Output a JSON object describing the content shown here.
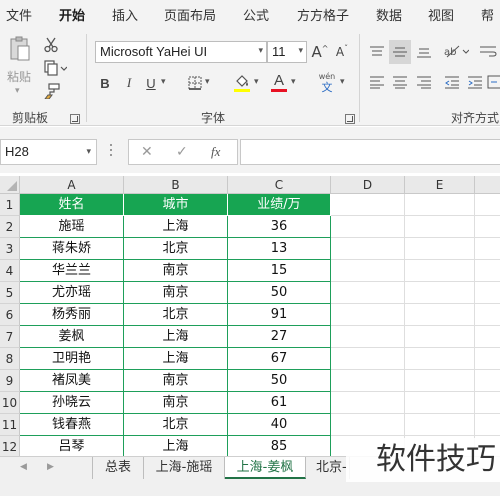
{
  "menu": [
    "文件",
    "开始",
    "插入",
    "页面布局",
    "公式",
    "方方格子",
    "数据",
    "视图",
    "帮"
  ],
  "ribbon": {
    "paste_label": "粘贴",
    "font_name": "Microsoft YaHei UI",
    "font_size": "11",
    "bold": "B",
    "italic": "I",
    "underline": "U",
    "font_color_letter": "A",
    "phonetic_top": "wén",
    "phonetic_bottom": "文",
    "grow_font": "A",
    "shrink_font": "A",
    "clipboard_label": "剪贴板",
    "font_label": "字体",
    "align_label": "对齐方式",
    "font_color": "#e81123",
    "fill_color": "#ffff00"
  },
  "formula_bar": {
    "name_box": "H28",
    "cancel_glyph": "✕",
    "enter_glyph": "✓",
    "fx_label": "fx",
    "formula": ""
  },
  "sheet": {
    "columns": [
      "A",
      "B",
      "C",
      "D",
      "E"
    ],
    "row_numbers": [
      "1",
      "2",
      "3",
      "4",
      "5",
      "6",
      "7",
      "8",
      "9",
      "10",
      "11",
      "12"
    ],
    "header": [
      "姓名",
      "城市",
      "业绩/万"
    ],
    "rows": [
      [
        "施瑶",
        "上海",
        "36"
      ],
      [
        "蒋朱娇",
        "北京",
        "13"
      ],
      [
        "华兰兰",
        "南京",
        "15"
      ],
      [
        "尤亦瑶",
        "南京",
        "50"
      ],
      [
        "杨秀丽",
        "北京",
        "91"
      ],
      [
        "姜枫",
        "上海",
        "27"
      ],
      [
        "卫明艳",
        "上海",
        "67"
      ],
      [
        "褚凤美",
        "南京",
        "50"
      ],
      [
        "孙晓云",
        "南京",
        "61"
      ],
      [
        "钱春燕",
        "北京",
        "40"
      ],
      [
        "吕琴",
        "上海",
        "85"
      ]
    ],
    "header_color": "#17a552",
    "border_color": "#1e9f5a"
  },
  "sheet_tabs": [
    "总表",
    "上海-施瑶",
    "上海-姜枫",
    "北京-"
  ],
  "active_tab_index": 2,
  "watermark": "软件技巧"
}
